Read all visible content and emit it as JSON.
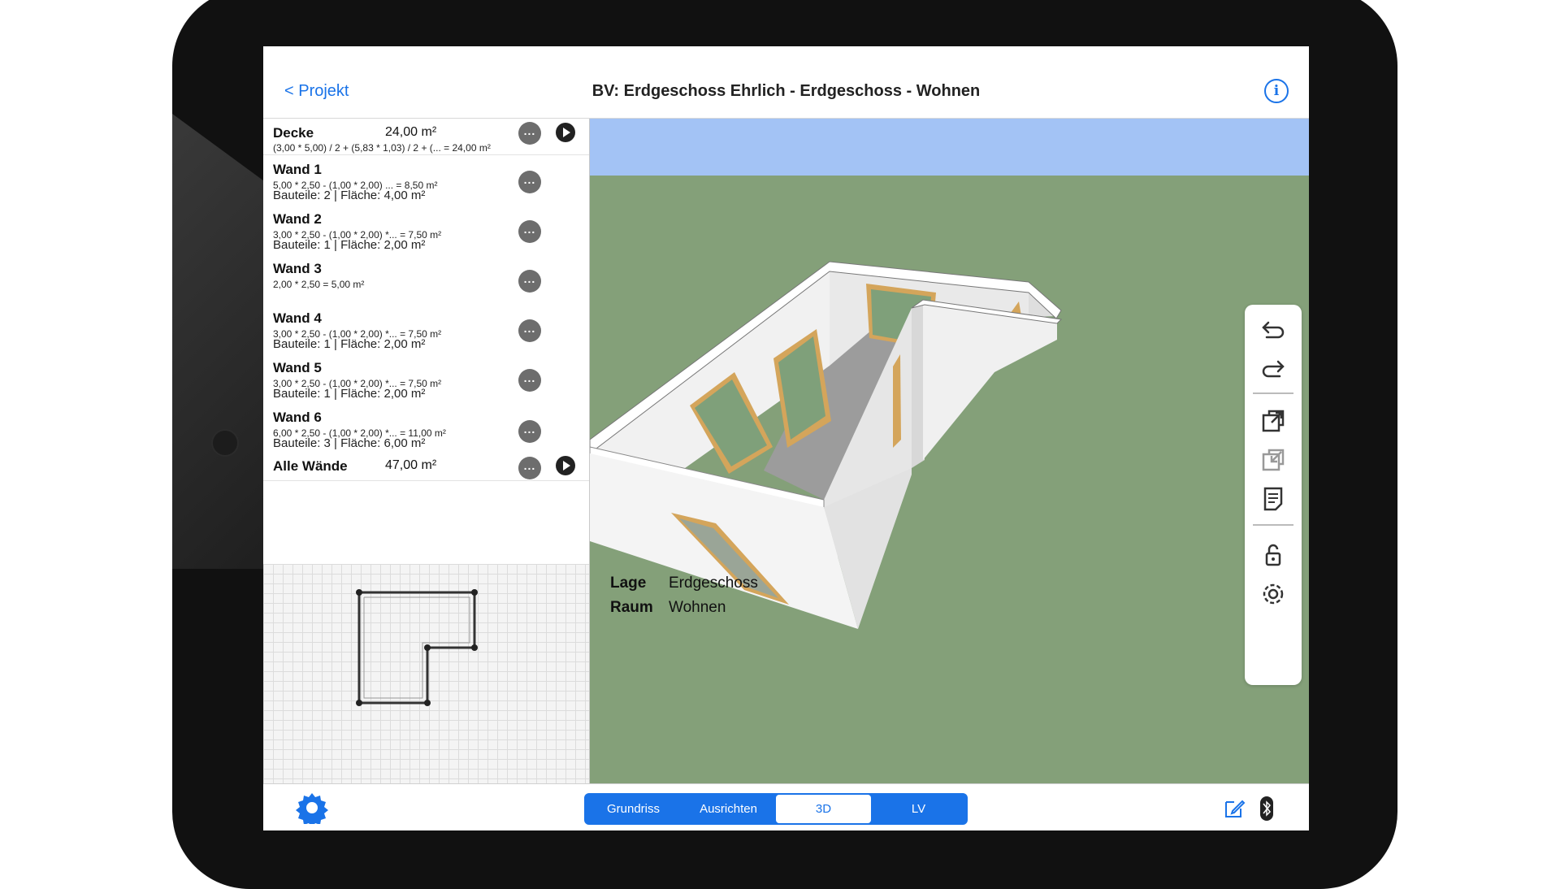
{
  "nav": {
    "back_label": "< Projekt",
    "title": "BV: Erdgeschoss Ehrlich - Erdgeschoss - Wohnen",
    "info_icon": "info-icon"
  },
  "list": {
    "decke": {
      "title": "Decke",
      "area": "24,00 m²",
      "formula": "(3,00 * 5,00) / 2  + (5,83 * 1,03) / 2  + (... = 24,00 m²"
    },
    "walls": [
      {
        "title": "Wand 1",
        "formula": "5,00 * 2,50  - (1,00 * 2,00)  ... = 8,50 m²",
        "info": "Bauteile: 2 | Fläche: 4,00 m²"
      },
      {
        "title": "Wand 2",
        "formula": "3,00 * 2,50  - (1,00 * 2,00) *... = 7,50 m²",
        "info": "Bauteile: 1 | Fläche: 2,00 m²"
      },
      {
        "title": "Wand 3",
        "formula": "2,00 * 2,50   = 5,00 m²",
        "info": ""
      },
      {
        "title": "Wand 4",
        "formula": "3,00 * 2,50  - (1,00 * 2,00) *... = 7,50 m²",
        "info": "Bauteile: 1 | Fläche: 2,00 m²"
      },
      {
        "title": "Wand 5",
        "formula": "3,00 * 2,50  - (1,00 * 2,00) *... = 7,50 m²",
        "info": "Bauteile: 1 | Fläche: 2,00 m²"
      },
      {
        "title": "Wand 6",
        "formula": "6,00 * 2,50  - (1,00 * 2,00) *... = 11,00 m²",
        "info": "Bauteile: 3 | Fläche: 6,00 m²"
      }
    ],
    "total": {
      "title": "Alle Wände",
      "area": "47,00 m²"
    },
    "more_label": "..."
  },
  "meta": {
    "lage_label": "Lage",
    "lage_value": "Erdgeschoss",
    "raum_label": "Raum",
    "raum_value": "Wohnen"
  },
  "toolbar": [
    "undo-icon",
    "redo-icon",
    "export-icon",
    "import-icon",
    "notes-icon",
    "lock-icon",
    "settings-icon"
  ],
  "tabs": [
    {
      "label": "Grundriss",
      "active": false
    },
    {
      "label": "Ausrichten",
      "active": false
    },
    {
      "label": "3D",
      "active": true
    },
    {
      "label": "LV",
      "active": false
    }
  ],
  "colors": {
    "accent": "#1a73e8",
    "ground": "#84a079",
    "sky": "#a3c3f5",
    "door": "#d4a55b"
  }
}
